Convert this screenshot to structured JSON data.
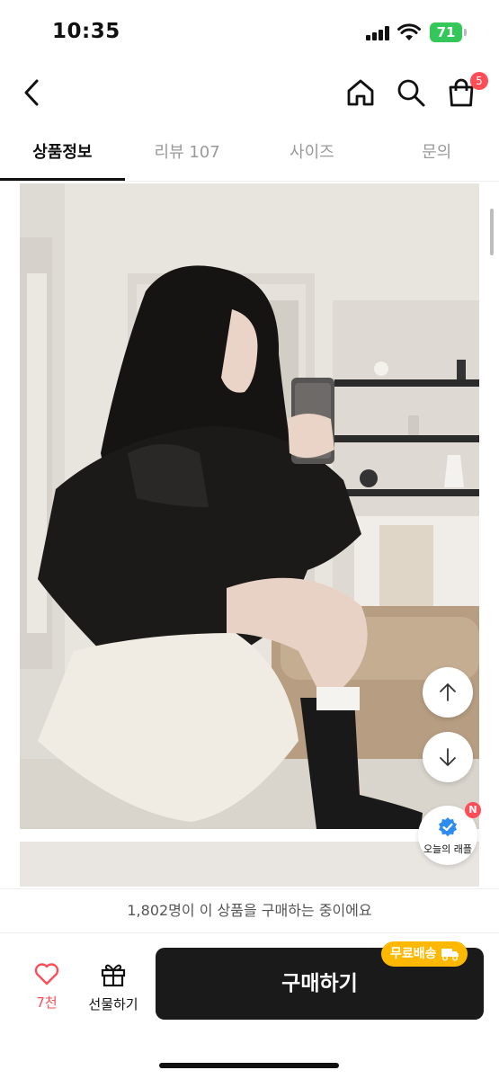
{
  "status_bar": {
    "time": "10:35",
    "battery": "71"
  },
  "header": {
    "icons": [
      "chevron-left-icon",
      "home-icon",
      "search-icon",
      "shopping-bag-icon"
    ],
    "cart_badge": "5"
  },
  "tabs": [
    {
      "label": "상품정보",
      "active": true
    },
    {
      "label": "리뷰 107",
      "active": false
    },
    {
      "label": "사이즈",
      "active": false
    },
    {
      "label": "문의",
      "active": false
    }
  ],
  "floating": {
    "raffle_label": "오늘의 래플",
    "raffle_badge": "N"
  },
  "buyers_notice": "1,802명이 이 상품을 구매하는 중이에요",
  "bottom_bar": {
    "like_count": "7천",
    "gift_label": "선물하기",
    "buy_label": "구매하기",
    "free_shipping_label": "무료배송"
  },
  "colors": {
    "accent": "#ff4d57",
    "buy_button": "#1a1a1a",
    "free_shipping": "#ffb800",
    "battery": "#34c759",
    "verified": "#2d8cf0"
  }
}
